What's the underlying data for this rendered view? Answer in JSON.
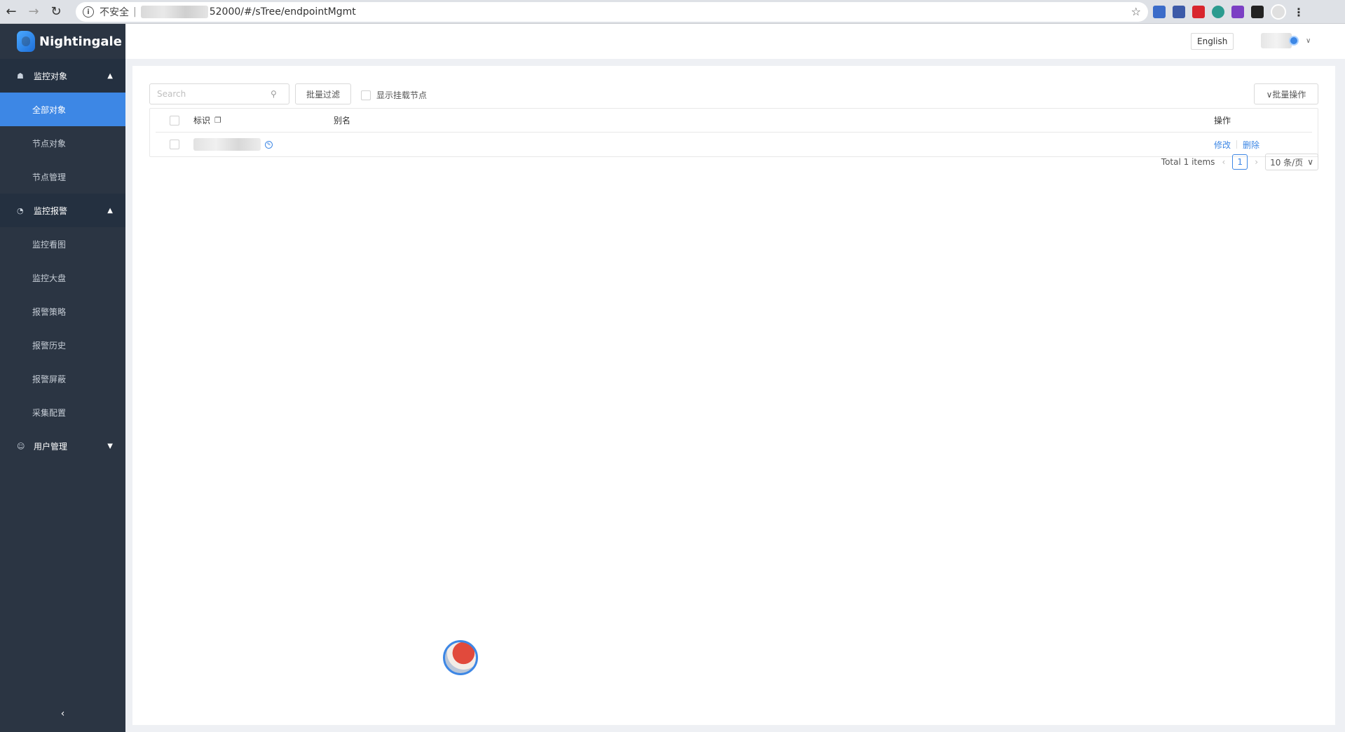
{
  "browser": {
    "security_label": "不安全",
    "url": "52000/#/sTree/endpointMgmt"
  },
  "app": {
    "name": "Nightingale"
  },
  "sidebar": {
    "groups": [
      {
        "label": "监控对象",
        "items": [
          {
            "label": "全部对象",
            "active": true
          },
          {
            "label": "节点对象"
          },
          {
            "label": "节点管理"
          }
        ]
      },
      {
        "label": "监控报警",
        "items": [
          {
            "label": "监控看图"
          },
          {
            "label": "监控大盘"
          },
          {
            "label": "报警策略"
          },
          {
            "label": "报警历史"
          },
          {
            "label": "报警屏蔽"
          },
          {
            "label": "采集配置"
          }
        ]
      },
      {
        "label": "用户管理",
        "items": []
      }
    ],
    "collapse_icon": "‹"
  },
  "header": {
    "language_label": "English"
  },
  "toolbar": {
    "search_placeholder": "Search",
    "batch_filter_label": "批量过滤",
    "show_mount_nodes_label": "显示挂载节点",
    "batch_ops_label": "∨批量操作"
  },
  "table": {
    "columns": {
      "ident": "标识",
      "alias": "别名",
      "ops": "操作"
    },
    "rows": [
      {
        "edit_label": "修改",
        "delete_label": "删除"
      }
    ]
  },
  "pagination": {
    "total_label": "Total 1 items",
    "current_page": "1",
    "page_size_label": "10 条/页"
  },
  "colors": {
    "sidebar_bg": "#2b3543",
    "accent": "#3d87e5"
  }
}
